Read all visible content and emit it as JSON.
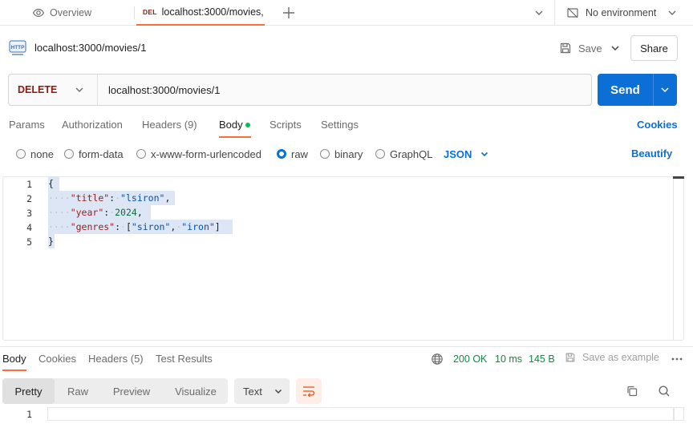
{
  "tabbar": {
    "overview_label": "Overview",
    "active_tab": {
      "method": "DEL",
      "title": "localhost:3000/movies,"
    },
    "environment_label": "No environment"
  },
  "request": {
    "title": "localhost:3000/movies/1",
    "save_label": "Save",
    "share_label": "Share",
    "method": "DELETE",
    "url": "localhost:3000/movies/1",
    "send_label": "Send"
  },
  "request_tabs": [
    {
      "label": "Params"
    },
    {
      "label": "Authorization"
    },
    {
      "label": "Headers (9)"
    },
    {
      "label": "Body"
    },
    {
      "label": "Scripts"
    },
    {
      "label": "Settings"
    }
  ],
  "cookies_label": "Cookies",
  "body_types": [
    {
      "label": "none",
      "selected": false
    },
    {
      "label": "form-data",
      "selected": false
    },
    {
      "label": "x-www-form-urlencoded",
      "selected": false
    },
    {
      "label": "raw",
      "selected": true
    },
    {
      "label": "binary",
      "selected": false
    },
    {
      "label": "GraphQL",
      "selected": false
    }
  ],
  "format_selected": "JSON",
  "beautify_label": "Beautify",
  "editor": {
    "line_numbers": [
      "1",
      "2",
      "3",
      "4",
      "5"
    ],
    "open_brace": "{",
    "close_brace": "}",
    "title_key": "\"title\"",
    "title_val": "\"lsiron\"",
    "year_key": "\"year\"",
    "year_val": "2024",
    "genres_key": "\"genres\"",
    "genre_1": "\"siron\"",
    "genre_2": "\"iron\""
  },
  "response": {
    "tabs": [
      {
        "label": "Body"
      },
      {
        "label": "Cookies"
      },
      {
        "label": "Headers (5)"
      },
      {
        "label": "Test Results"
      }
    ],
    "status": "200 OK",
    "time": "10 ms",
    "size": "145 B",
    "save_example_label": "Save as example",
    "view_modes": [
      "Pretty",
      "Raw",
      "Preview",
      "Visualize"
    ],
    "text_format": "Text",
    "line_number": "1"
  },
  "colors": {
    "accent": "#ff6c37",
    "primary": "#0b6fd6",
    "delete_method": "#8e1a10",
    "success": "#0f8a3e"
  }
}
